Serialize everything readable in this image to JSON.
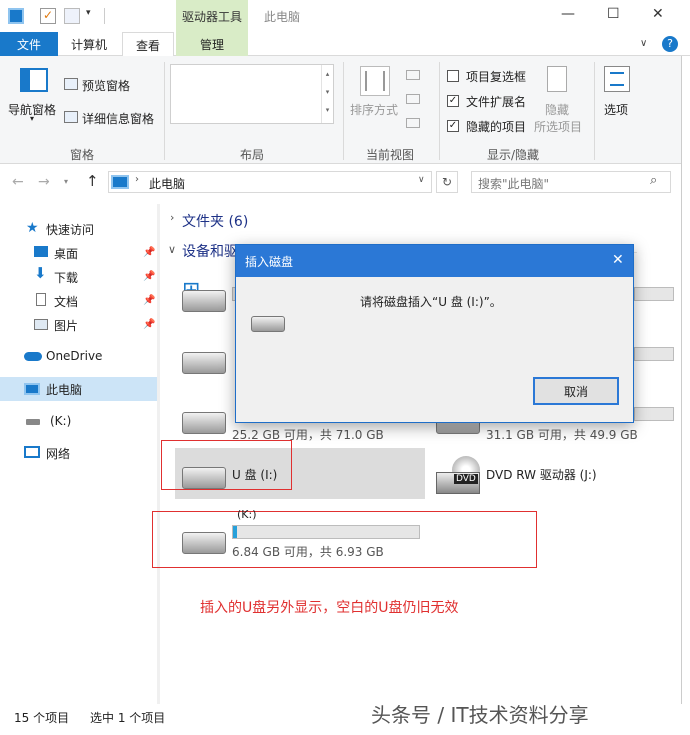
{
  "window": {
    "title": "此电脑",
    "context_tab": "驱动器工具",
    "controls": {
      "minimize": "—",
      "maximize": "☐",
      "close": "✕"
    },
    "help_icon": "?"
  },
  "ribbon_tabs": [
    "文件",
    "计算机",
    "查看",
    "管理"
  ],
  "ribbon": {
    "pane": {
      "nav_pane": "导航窗格",
      "preview": "预览窗格",
      "details": "详细信息窗格",
      "group": "窗格"
    },
    "layout_group": "布局",
    "current_view": {
      "sort": "排序方式",
      "group": "当前视图"
    },
    "show_hide": {
      "item_checkbox": "项目复选框",
      "file_ext": "文件扩展名",
      "hidden_items": "隐藏的项目",
      "hide": "隐藏",
      "selected_items": "所选项目",
      "options": "选项",
      "group": "显示/隐藏"
    }
  },
  "address": {
    "path": "此电脑",
    "search_placeholder": "搜索\"此电脑\""
  },
  "nav": {
    "quick_access": "快速访问",
    "desktop": "桌面",
    "downloads": "下载",
    "documents": "文档",
    "pictures": "图片",
    "onedrive": "OneDrive",
    "this_pc": "此电脑",
    "k_drive": "(K:)",
    "network": "网络"
  },
  "content": {
    "folders_header": "文件夹 (6)",
    "devices_header": "设备和驱动器 (6)",
    "drive3_free": "25.2 GB 可用，共 71.0 GB",
    "drive4_free": "31.1 GB 可用，共 49.9 GB",
    "u_disk": "U 盘 (I:)",
    "dvd": "DVD RW 驱动器 (J:)",
    "dvd_badge": "DVD",
    "k_label": "(K:)",
    "k_free": "6.84 GB 可用，共 6.93 GB",
    "annotation": "插入的U盘另外显示，空白的U盘仍旧无效"
  },
  "dialog": {
    "title": "插入磁盘",
    "message": "请将磁盘插入“U 盘 (I:)”。",
    "cancel": "取消",
    "close": "✕"
  },
  "status": {
    "count": "15 个项目",
    "selected": "选中 1 个项目"
  },
  "watermark": "头条号 / IT技术资料分享",
  "colors": {
    "accent": "#1979ca",
    "tools_tab": "#d9ecc7",
    "dialog_title": "#2b78d6",
    "highlight": "#e03030"
  }
}
